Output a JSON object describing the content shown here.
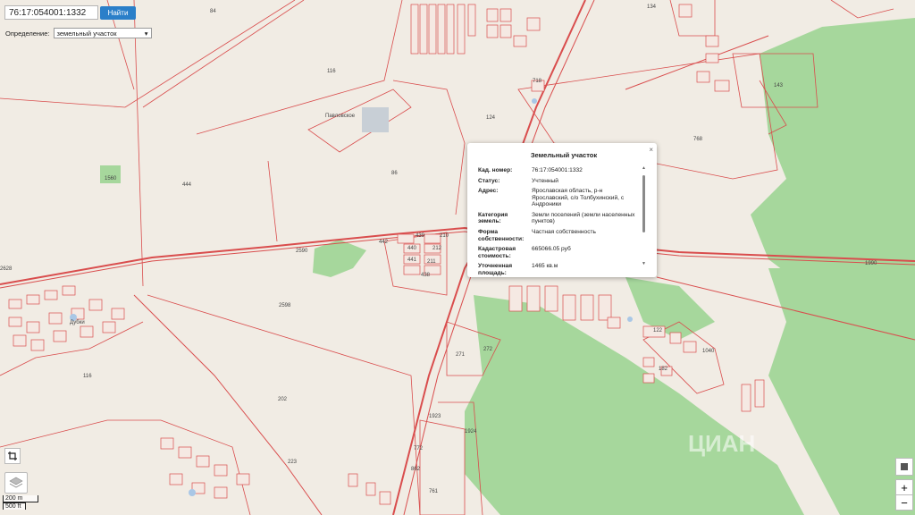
{
  "search": {
    "value": "76:17:054001:1332",
    "button_label": "Найти"
  },
  "definition": {
    "label": "Определение:",
    "selected": "земельный участок"
  },
  "popup": {
    "title": "Земельный участок",
    "rows": [
      {
        "label": "Кад. номер:",
        "value": "76:17:054001:1332"
      },
      {
        "label": "Статус:",
        "value": "Учтенный"
      },
      {
        "label": "Адрес:",
        "value": "Ярославская область, р-н Ярославский, с/о Толбухинский, с Андроники"
      },
      {
        "label": "Категория земель:",
        "value": "Земли поселений (земли населенных пунктов)"
      },
      {
        "label": "Форма собственности:",
        "value": "Частная собственность"
      },
      {
        "label": "Кадастровая стоимость:",
        "value": "665066.05 руб"
      },
      {
        "label": "Уточненная площадь:",
        "value": "1465 кв.м"
      }
    ]
  },
  "scale": {
    "metric": "200 m",
    "imperial": "500 ft"
  },
  "zoom": {
    "in": "+",
    "out": "−"
  },
  "map": {
    "place_labels": [
      "Павловское",
      "Дубки"
    ],
    "watermark": "ЦИАН",
    "plot_numbers": [
      "84",
      "116",
      "444",
      "1560",
      "86",
      "124",
      "134",
      "143",
      "768",
      "2628",
      "2590",
      "442",
      "439",
      "210",
      "440",
      "212",
      "441",
      "211",
      "438",
      "2598",
      "271",
      "272",
      "1040",
      "182",
      "122",
      "116",
      "202",
      "223",
      "1923",
      "772",
      "862",
      "761",
      "1924",
      "1990",
      "718"
    ]
  },
  "colors": {
    "boundary": "#d94d4d",
    "forest": "#a6d79c",
    "background": "#f1ece4",
    "button": "#2a7fc9"
  }
}
